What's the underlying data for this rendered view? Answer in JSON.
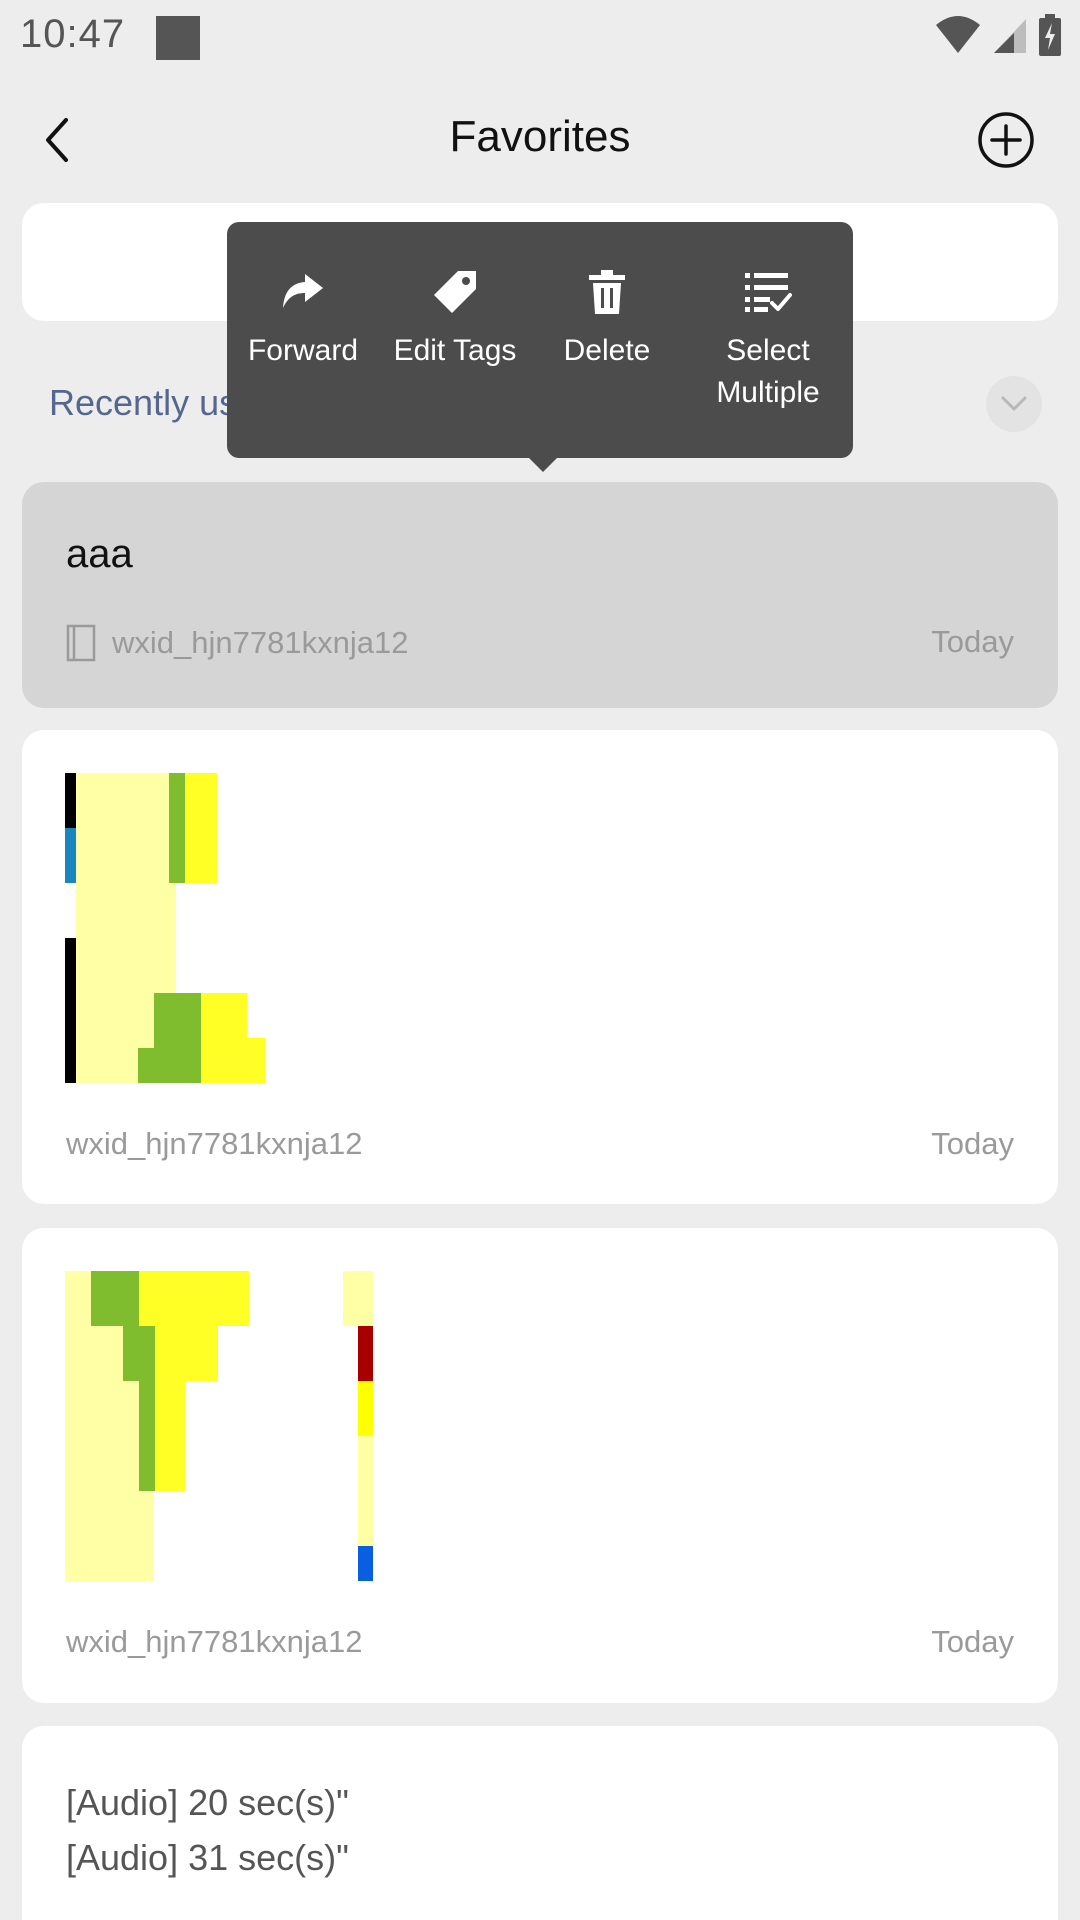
{
  "status_bar": {
    "time": "10:47",
    "icons": [
      "notification-square-icon",
      "wifi-icon",
      "cellular-signal-icon",
      "battery-charging-icon"
    ]
  },
  "header": {
    "title": "Favorites",
    "back_icon": "chevron-left-icon",
    "add_icon": "plus-circle-icon"
  },
  "recent": {
    "label": "Recently used",
    "toggle_icon": "chevron-down-icon"
  },
  "context_menu": {
    "items": [
      {
        "label": "Forward",
        "icon": "forward-arrow-icon"
      },
      {
        "label": "Edit Tags",
        "icon": "tag-icon"
      },
      {
        "label": "Delete",
        "icon": "trash-icon"
      },
      {
        "label": "Select\nMultiple",
        "icon": "multi-select-list-icon"
      }
    ]
  },
  "cards": [
    {
      "title": "aaa",
      "source": "wxid_hjn7781kxnja12",
      "date": "Today",
      "source_icon": "note-book-icon"
    },
    {
      "source": "wxid_hjn7781kxnja12",
      "date": "Today"
    },
    {
      "source": "wxid_hjn7781kxnja12",
      "date": "Today"
    },
    {
      "lines": [
        "[Audio] 20 sec(s)\"",
        "[Audio] 31 sec(s)\""
      ]
    }
  ],
  "colors": {
    "background": "#ededed",
    "card": "#ffffff",
    "card_highlight": "#d5d5d5",
    "menu": "#4c4c4c",
    "link": "#56678f",
    "muted": "#9a9a9a"
  }
}
